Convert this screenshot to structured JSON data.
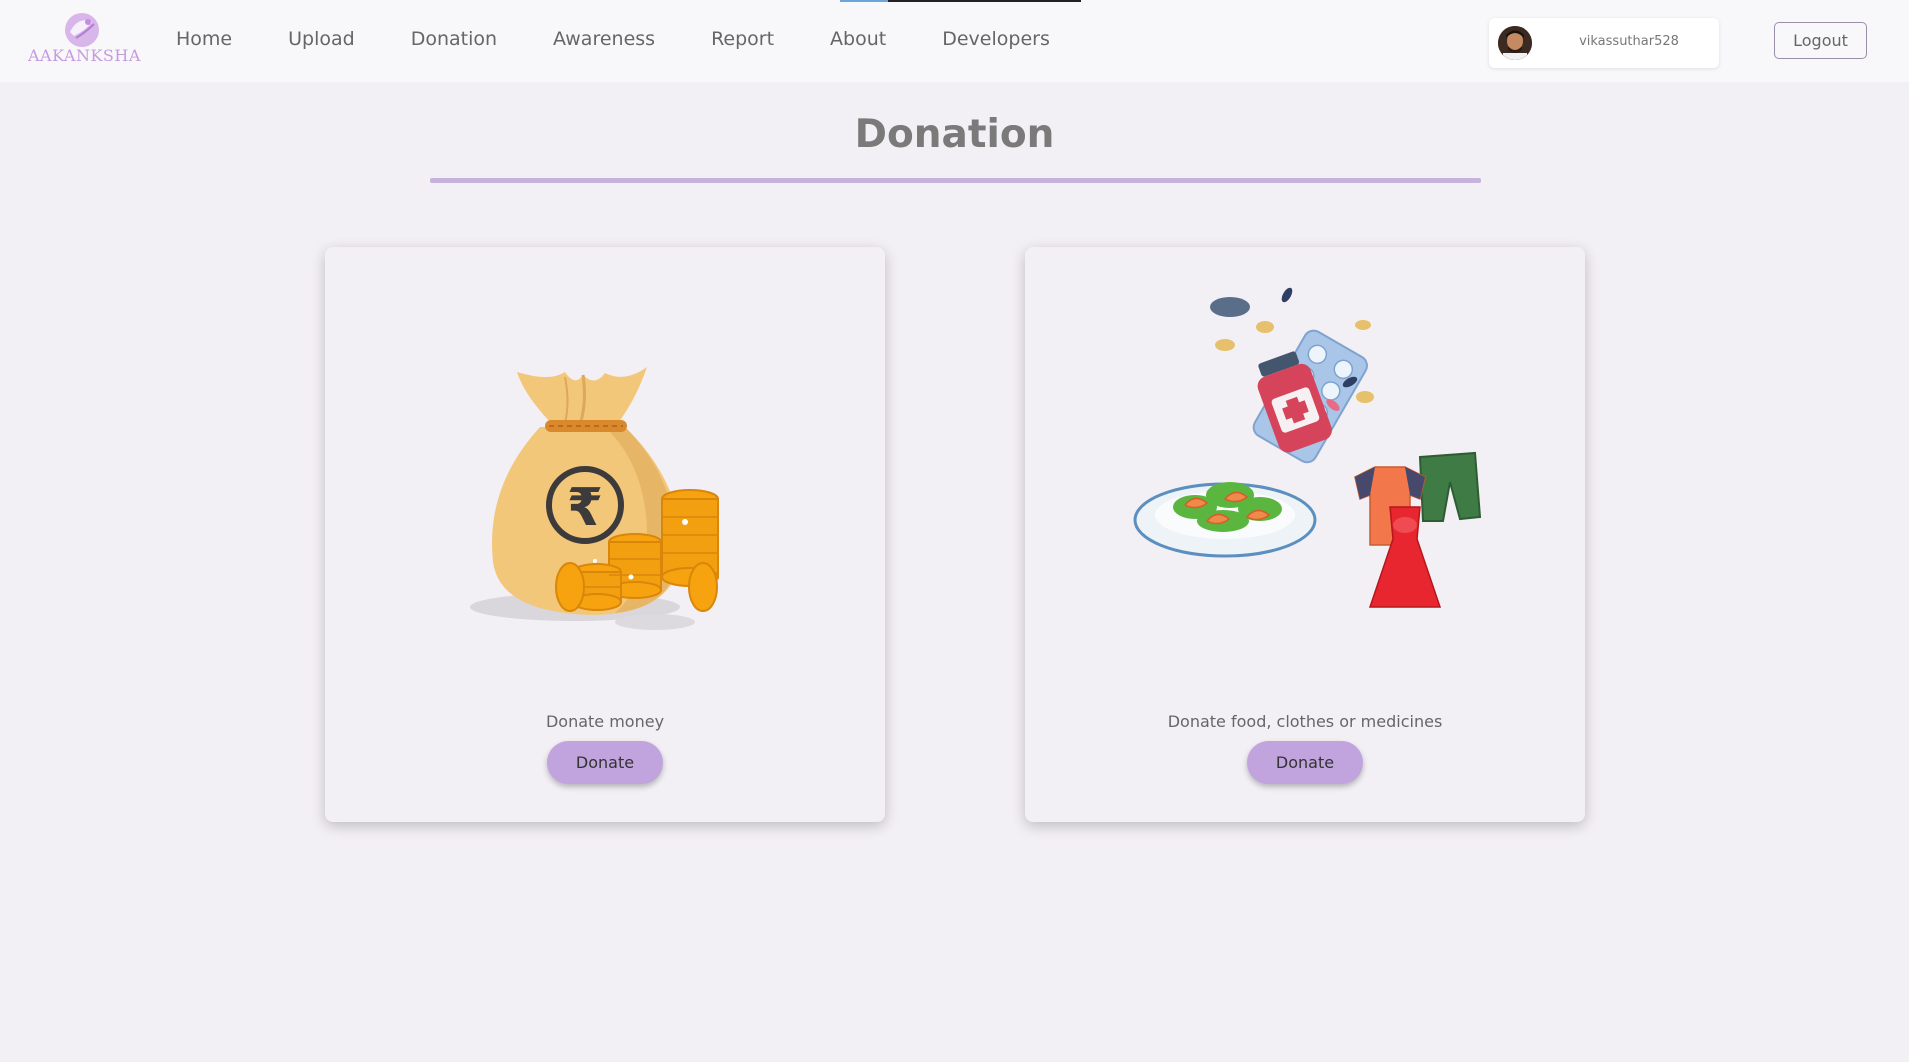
{
  "brand": {
    "logo_text": "AAKANKSHA",
    "logo_icon": "aakanksha-logo"
  },
  "nav": {
    "links": [
      {
        "label": "Home"
      },
      {
        "label": "Upload"
      },
      {
        "label": "Donation"
      },
      {
        "label": "Awareness"
      },
      {
        "label": "Report"
      },
      {
        "label": "About"
      },
      {
        "label": "Developers"
      }
    ]
  },
  "user": {
    "username": "vikassuthar528",
    "avatar_icon": "user-avatar"
  },
  "logout_label": "Logout",
  "page": {
    "title": "Donation"
  },
  "cards": [
    {
      "image_icon": "money-bag-rupee-illustration",
      "text": "Donate money",
      "button_label": "Donate"
    },
    {
      "image_icon": "food-clothes-medicine-illustration",
      "text": "Donate food, clothes or medicines",
      "button_label": "Donate"
    }
  ],
  "colors": {
    "accent": "#c1a3de",
    "rule": "#c7b2dd",
    "background": "#f3f0f5",
    "navbar": "#f8f8fa"
  }
}
